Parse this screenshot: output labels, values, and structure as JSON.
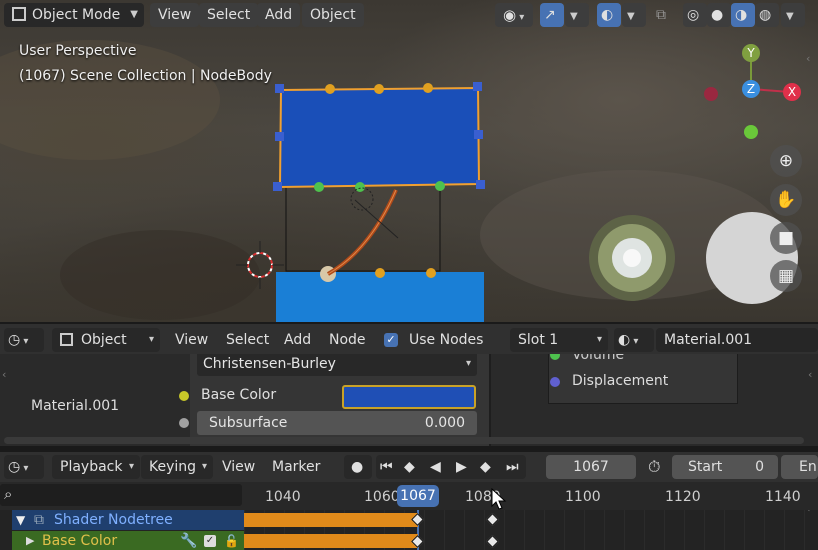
{
  "viewport": {
    "mode_label": "Object Mode",
    "menu": {
      "view": "View",
      "select": "Select",
      "add": "Add",
      "object": "Object"
    },
    "overlay_title": "User Perspective",
    "overlay_subtitle": "(1067) Scene Collection | NodeBody",
    "gizmo": {
      "y": "Y",
      "z": "Z",
      "x": "X"
    }
  },
  "shader_editor": {
    "object_type": "Object",
    "menu": {
      "view": "View",
      "select": "Select",
      "add": "Add",
      "node": "Node"
    },
    "use_nodes_label": "Use Nodes",
    "use_nodes_checked": true,
    "slot": "Slot 1",
    "material_name": "Material.001",
    "side_label": "Material.001",
    "node": {
      "subsurface_method": "Christensen-Burley",
      "base_color_label": "Base Color",
      "base_color_value": "#1f4fb5",
      "subsurface_label": "Subsurface",
      "subsurface_value": "0.000"
    },
    "output_node": {
      "volume": "Volume",
      "displacement": "Displacement"
    }
  },
  "timeline": {
    "menu": {
      "playback": "Playback",
      "keying": "Keying",
      "view": "View",
      "marker": "Marker"
    },
    "current_frame": "1067",
    "start_label": "Start",
    "start_value": "0",
    "end_label": "En",
    "ruler": [
      "1040",
      "1060",
      "1080",
      "1100",
      "1120",
      "1140"
    ],
    "playhead": "1067",
    "channels": [
      {
        "name": "Shader Nodetree",
        "color": "#5a8fd8"
      },
      {
        "name": "Base Color",
        "color": "#e0c04a"
      }
    ]
  },
  "colors": {
    "accent": "#4772b3",
    "keyframe_bar": "#e08a1a",
    "selection": "#f0a030"
  }
}
